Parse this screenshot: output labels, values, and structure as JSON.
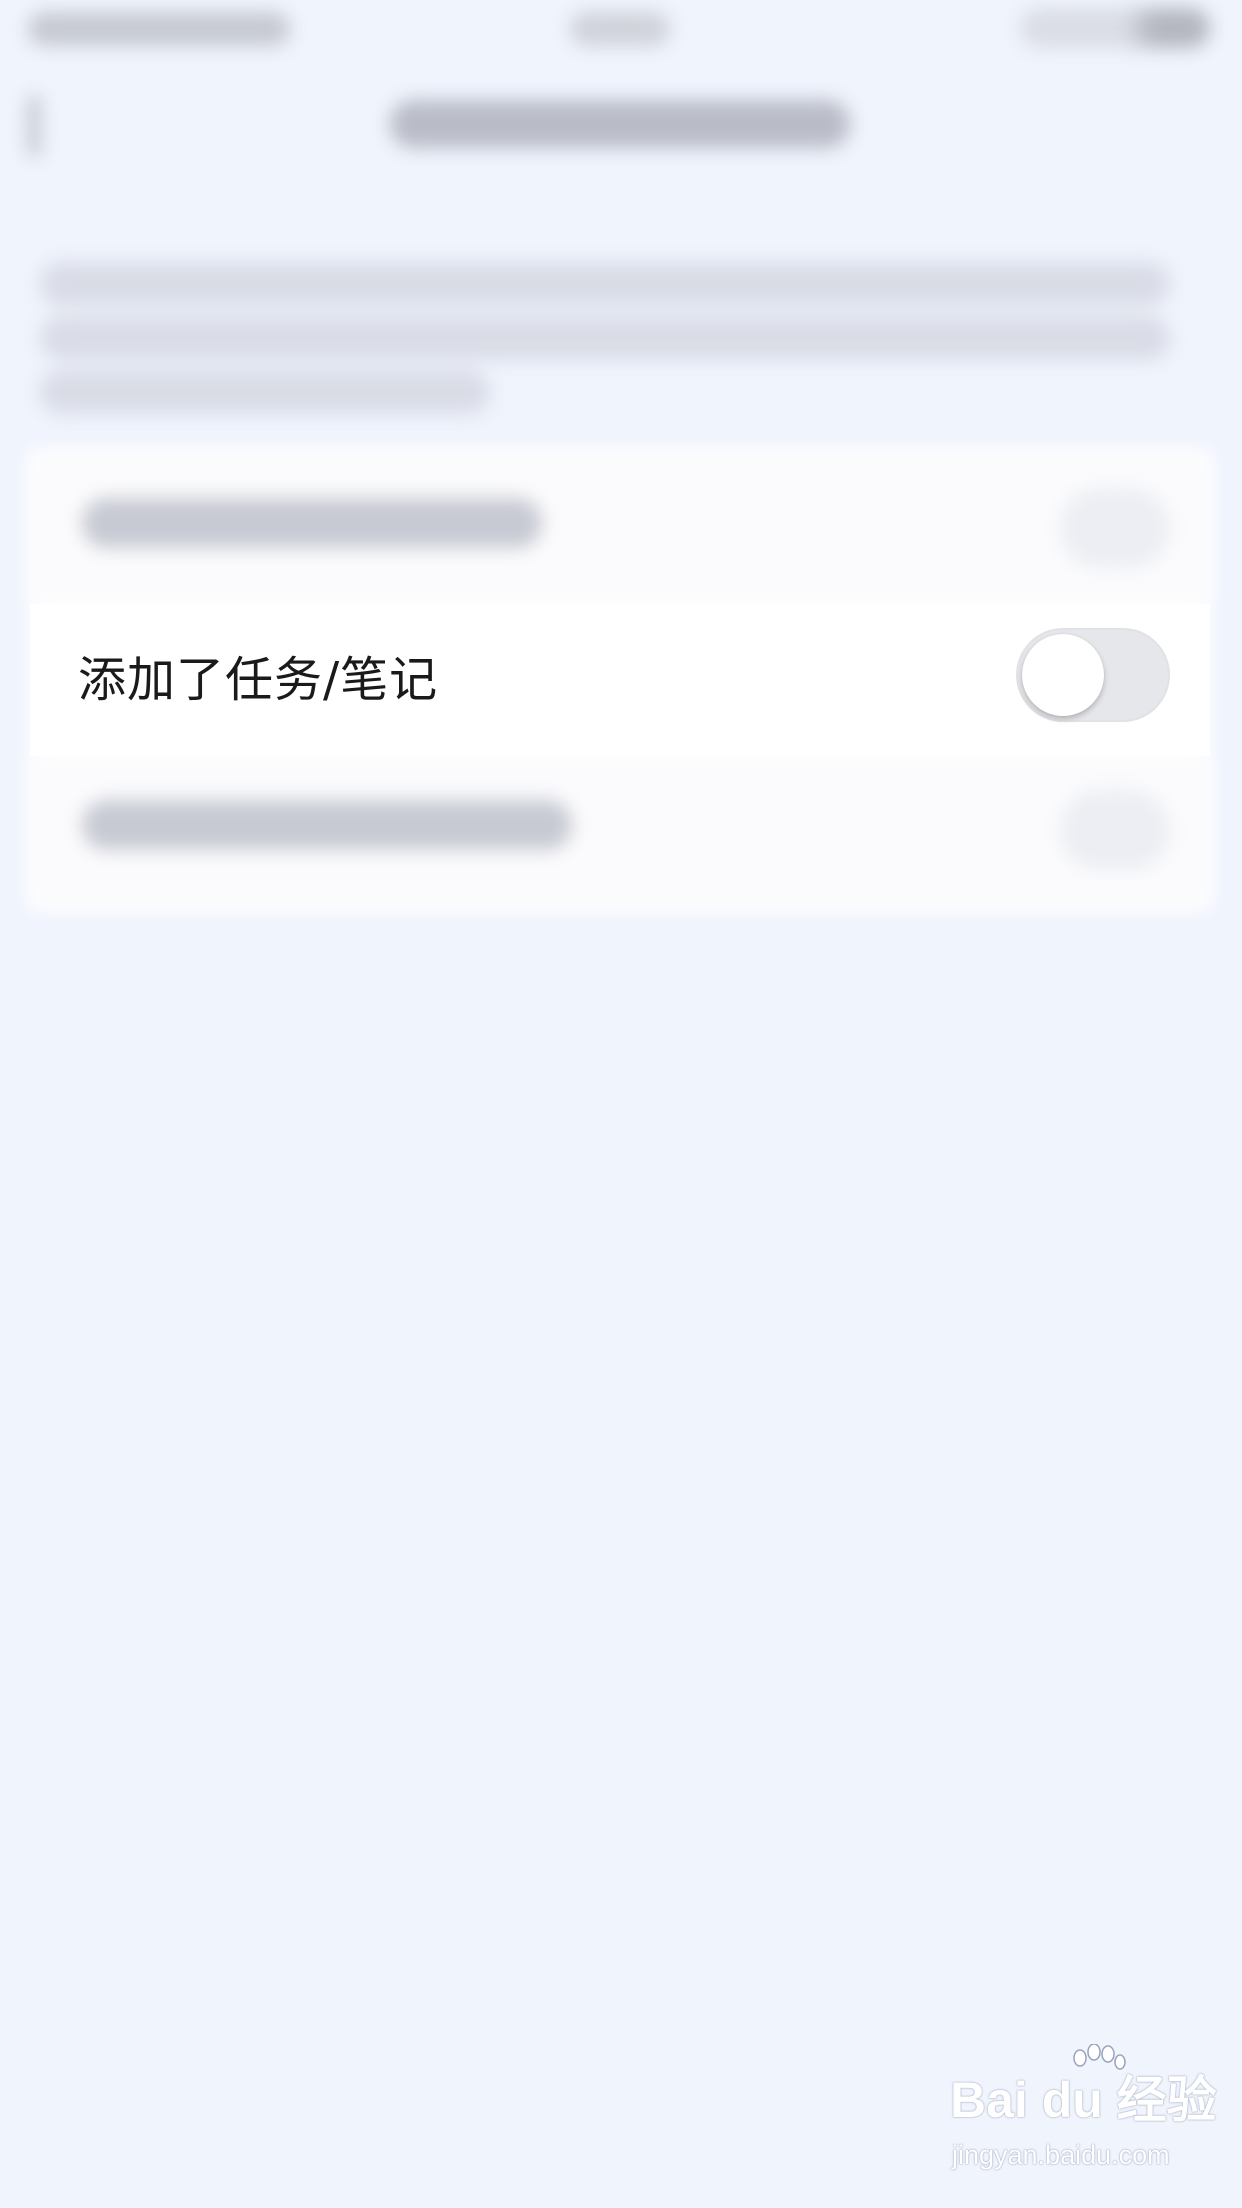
{
  "settings": {
    "focused_row": {
      "label": "添加了任务/笔记",
      "toggle_on": false
    }
  },
  "watermark": {
    "brand": "Bai du 经验",
    "url": "jingyan.baidu.com"
  },
  "colors": {
    "background": "#f0f4fd",
    "card": "#ffffff",
    "toggle_off_track": "#e6e7ea",
    "toggle_knob": "#ffffff",
    "label_text": "#1a1a1a"
  },
  "icons": {
    "back": "back-chevron-icon",
    "toggle_knob": "toggle-knob",
    "watermark_paw": "paw-icon"
  }
}
